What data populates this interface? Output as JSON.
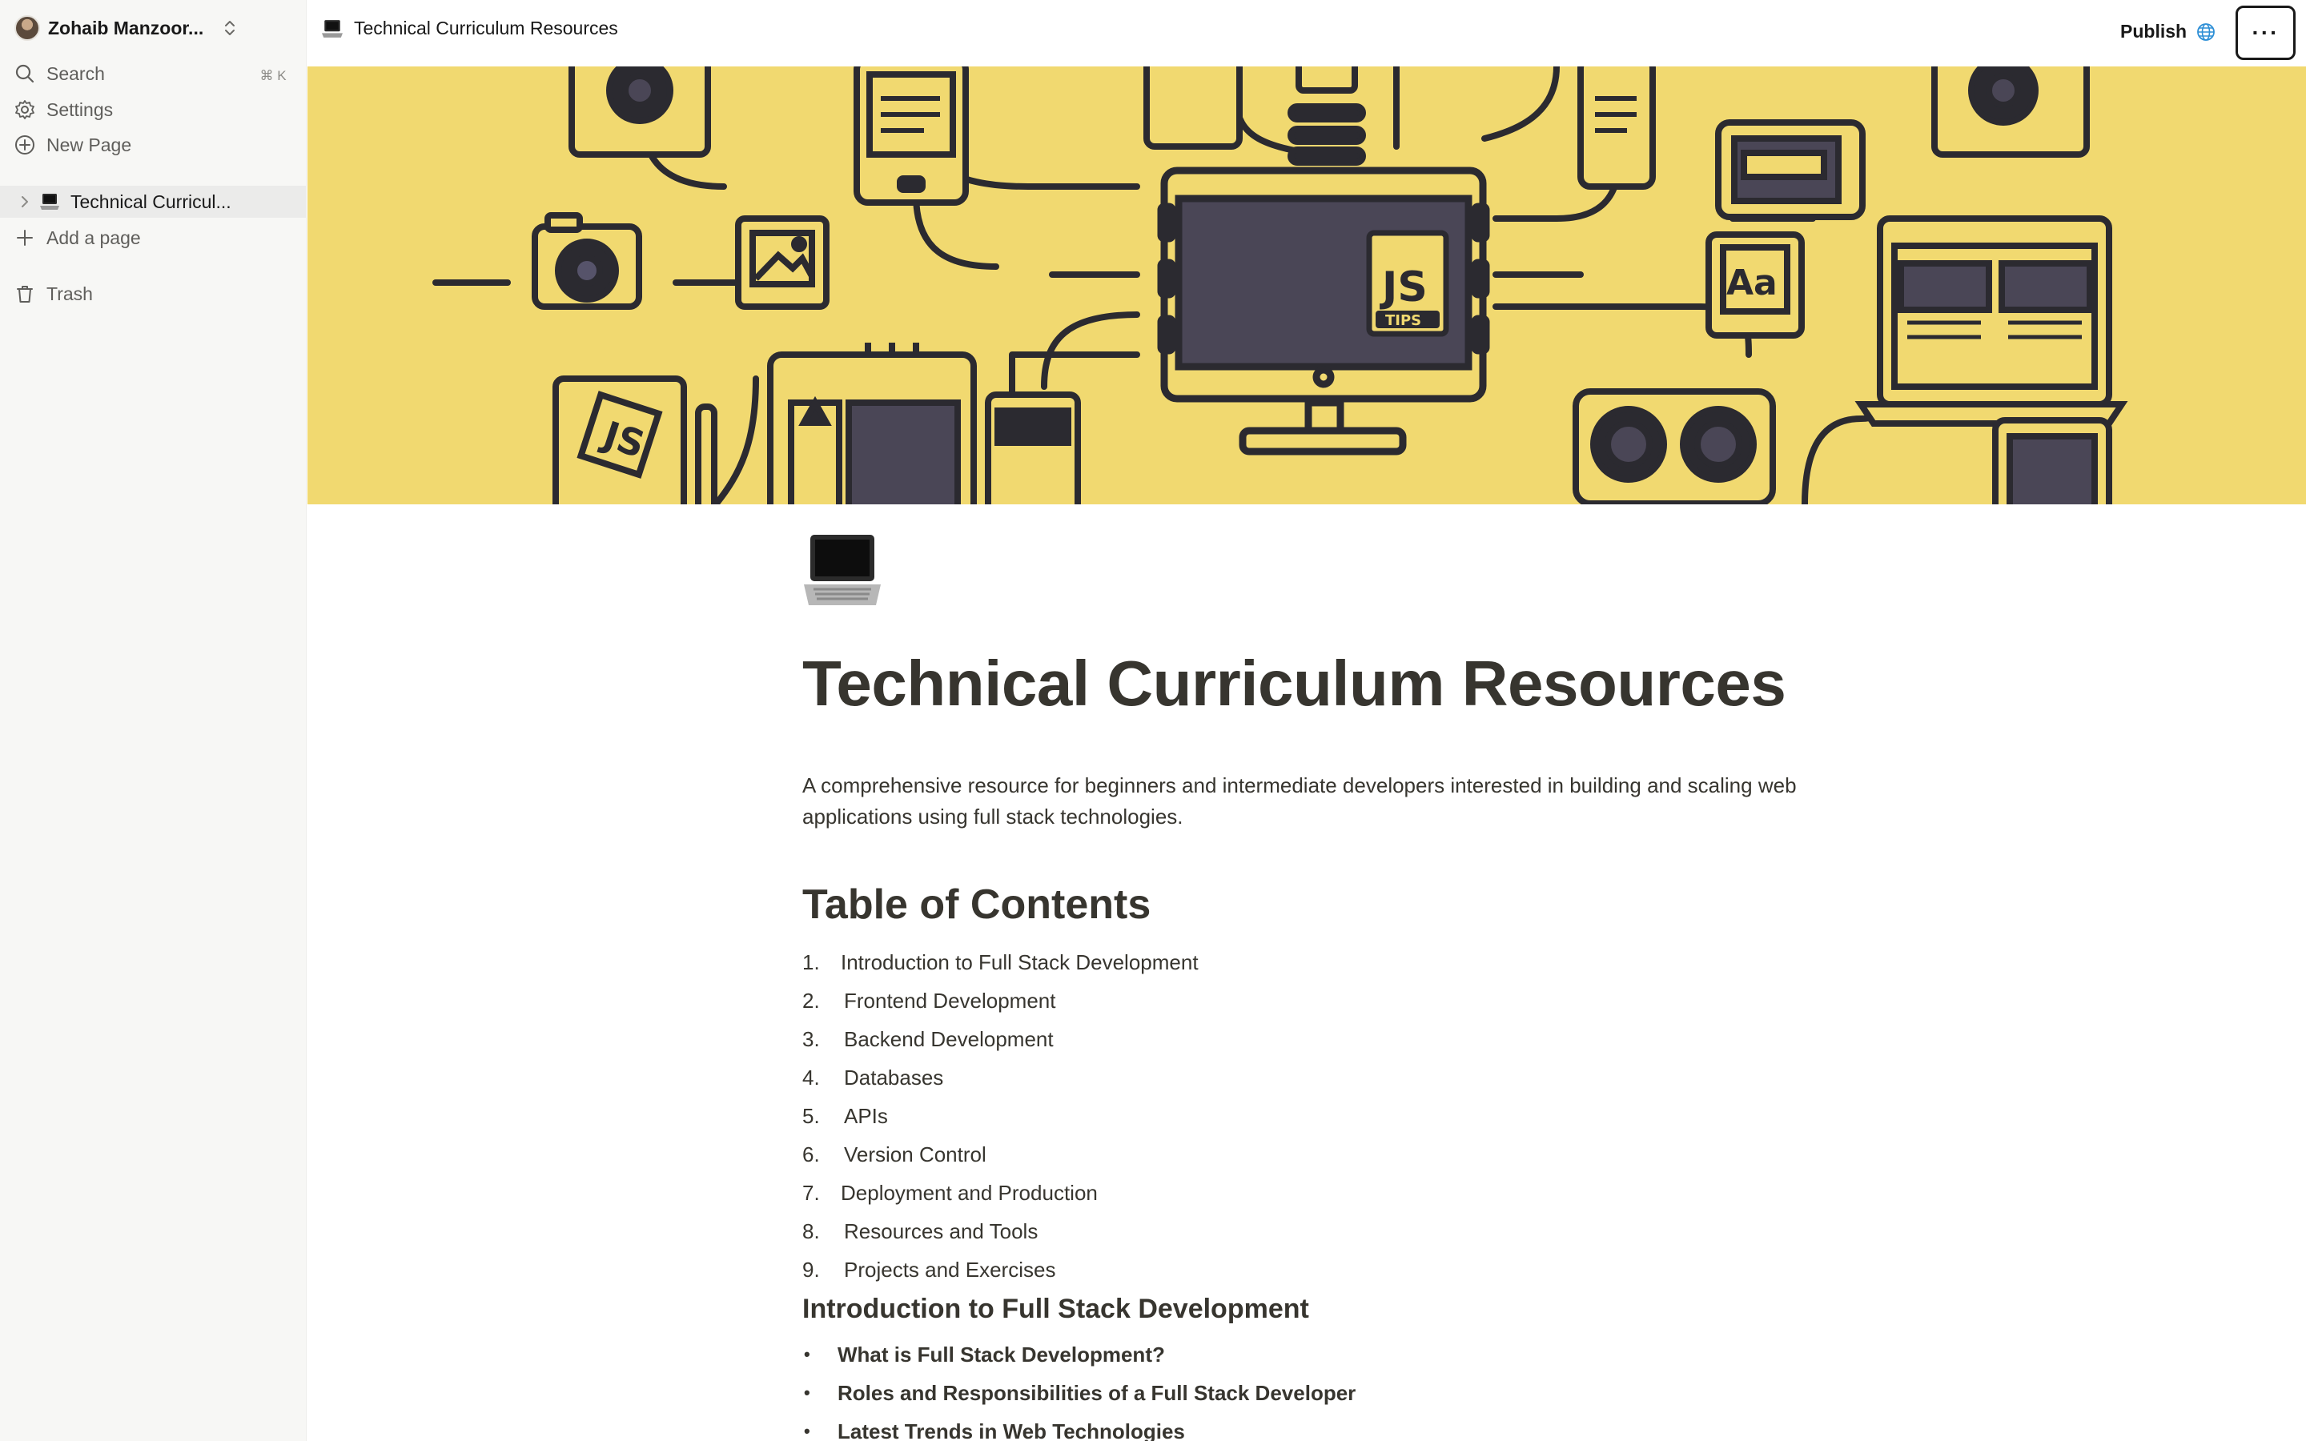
{
  "sidebar": {
    "workspace_name": "Zohaib Manzoor...",
    "search_label": "Search",
    "search_shortcut": "⌘ K",
    "settings_label": "Settings",
    "new_page_label": "New Page",
    "page_tree": [
      {
        "label": "Technical Curricul...",
        "icon": "laptop-icon"
      }
    ],
    "add_page_label": "Add a page",
    "trash_label": "Trash"
  },
  "topbar": {
    "breadcrumb": "Technical Curriculum Resources",
    "publish_label": "Publish",
    "more_label": "···"
  },
  "cover": {
    "badge_js": "JS",
    "badge_tips": "TIPS",
    "badge_aa": "Aa",
    "book_js": "JS",
    "background_color": "#f1d970",
    "line_color": "#2b2a30"
  },
  "page": {
    "title": "Technical Curriculum Resources",
    "description": "A comprehensive resource for beginners and intermediate developers interested in building and scaling web applications using full stack technologies.",
    "toc_heading": "Table of Contents",
    "toc": [
      {
        "num": "1.",
        "label": "Introduction to Full Stack Development"
      },
      {
        "num": "2.",
        "label": "Frontend Development"
      },
      {
        "num": "3.",
        "label": "Backend Development"
      },
      {
        "num": "4.",
        "label": "Databases"
      },
      {
        "num": "5.",
        "label": "APIs"
      },
      {
        "num": "6.",
        "label": "Version Control"
      },
      {
        "num": "7.",
        "label": "Deployment and Production"
      },
      {
        "num": "8.",
        "label": "Resources and Tools"
      },
      {
        "num": "9.",
        "label": "Projects and Exercises"
      }
    ],
    "section_heading": "Introduction to Full Stack Development",
    "bullets": [
      "What is Full Stack Development?",
      "Roles and Responsibilities of a Full Stack Developer",
      "Latest Trends in Web Technologies"
    ]
  }
}
